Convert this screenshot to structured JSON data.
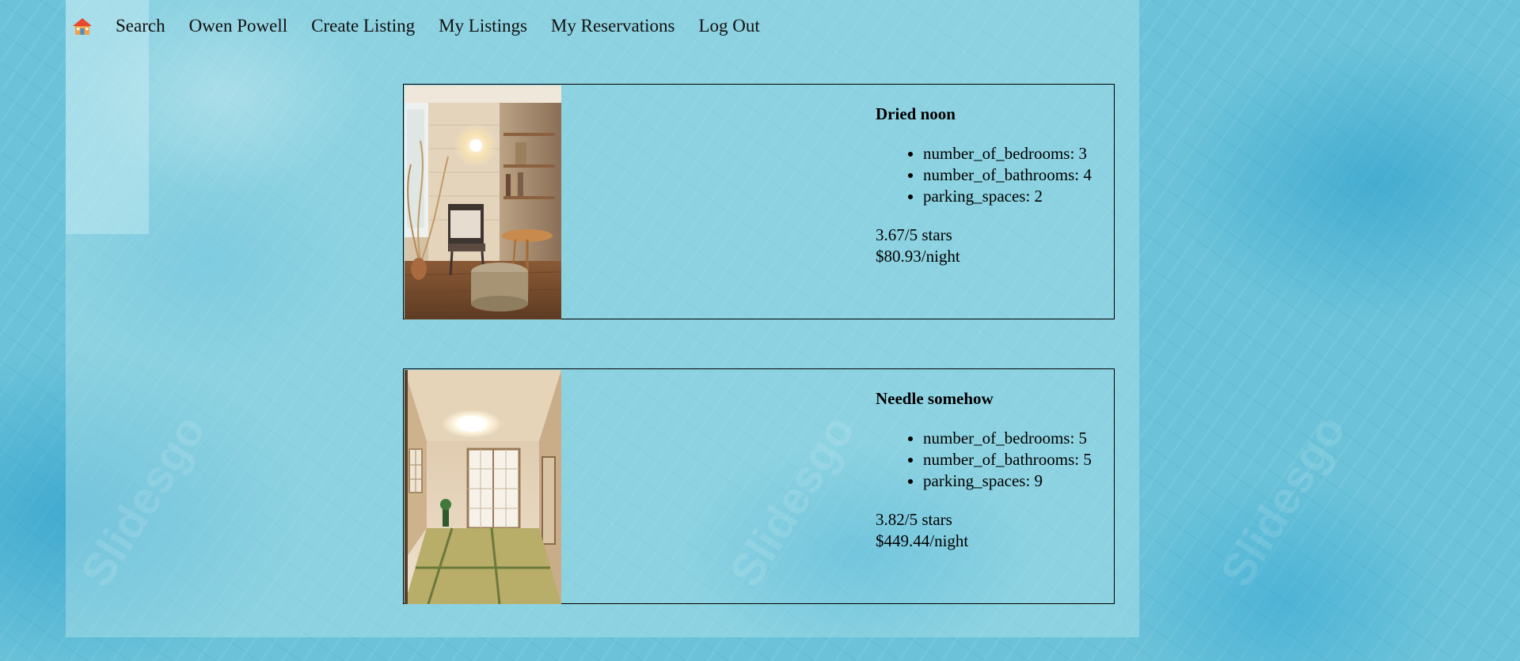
{
  "nav": {
    "home_icon": "home-icon",
    "links": [
      "Search",
      "Owen Powell",
      "Create Listing",
      "My Listings",
      "My Reservations",
      "Log Out"
    ]
  },
  "listings": [
    {
      "title": "Dried noon",
      "details": [
        "number_of_bedrooms: 3",
        "number_of_bathrooms: 4",
        "parking_spaces: 2"
      ],
      "rating": "3.67/5 stars",
      "price": "$80.93/night"
    },
    {
      "title": "Needle somehow",
      "details": [
        "number_of_bedrooms: 5",
        "number_of_bathrooms: 5",
        "parking_spaces: 9"
      ],
      "rating": "3.82/5 stars",
      "price": "$449.44/night"
    }
  ],
  "background": {
    "watermark": "Slidesgo"
  },
  "colors": {
    "background": "#6cc3d9",
    "border": "#000000"
  }
}
